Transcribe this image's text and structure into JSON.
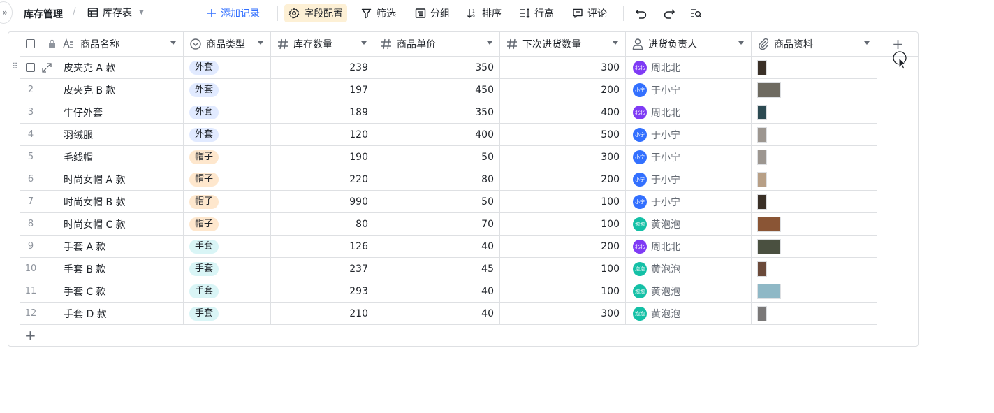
{
  "toolbar": {
    "expand_label": "»",
    "base_name": "库存管理",
    "separator": "/",
    "view_name": "库存表",
    "add_record": "添加记录",
    "field_config": "字段配置",
    "filter": "筛选",
    "group": "分组",
    "sort": "排序",
    "row_height": "行高",
    "comment": "评论"
  },
  "columns": [
    {
      "label": "商品名称",
      "icon": "text-field-icon"
    },
    {
      "label": "商品类型",
      "icon": "single-select-icon"
    },
    {
      "label": "库存数量",
      "icon": "number-field-icon"
    },
    {
      "label": "商品单价",
      "icon": "number-field-icon"
    },
    {
      "label": "下次进货数量",
      "icon": "number-field-icon"
    },
    {
      "label": "进货负责人",
      "icon": "person-field-icon"
    },
    {
      "label": "商品资料",
      "icon": "attachment-icon"
    }
  ],
  "tag_colors": {
    "外套": "#e1eaff",
    "帽子": "#fee7cd",
    "手套": "#d9f5f6"
  },
  "people": {
    "周北北": {
      "initials": "北北",
      "color": "#7f3bf5"
    },
    "于小宁": {
      "initials": "小宁",
      "color": "#3370ff"
    },
    "黄泡泡": {
      "initials": "泡泡",
      "color": "#14c0a6"
    }
  },
  "rows": [
    {
      "num": "",
      "name": "皮夹克 A 款",
      "type": "外套",
      "stock": "239",
      "price": "350",
      "next": "300",
      "owner": "周北北",
      "thumb": "portrait-dark"
    },
    {
      "num": "2",
      "name": "皮夹克 B 款",
      "type": "外套",
      "stock": "197",
      "price": "450",
      "next": "200",
      "owner": "于小宁",
      "thumb": "landscape-gray"
    },
    {
      "num": "3",
      "name": "牛仔外套",
      "type": "外套",
      "stock": "189",
      "price": "350",
      "next": "400",
      "owner": "周北北",
      "thumb": "portrait-teal"
    },
    {
      "num": "4",
      "name": "羽绒服",
      "type": "外套",
      "stock": "120",
      "price": "400",
      "next": "500",
      "owner": "于小宁",
      "thumb": "portrait-light"
    },
    {
      "num": "5",
      "name": "毛线帽",
      "type": "帽子",
      "stock": "190",
      "price": "50",
      "next": "300",
      "owner": "于小宁",
      "thumb": "portrait-light"
    },
    {
      "num": "6",
      "name": "时尚女帽 A 款",
      "type": "帽子",
      "stock": "220",
      "price": "80",
      "next": "200",
      "owner": "于小宁",
      "thumb": "portrait-beige"
    },
    {
      "num": "7",
      "name": "时尚女帽 B 款",
      "type": "帽子",
      "stock": "990",
      "price": "50",
      "next": "100",
      "owner": "于小宁",
      "thumb": "portrait-dark"
    },
    {
      "num": "8",
      "name": "时尚女帽 C 款",
      "type": "帽子",
      "stock": "80",
      "price": "70",
      "next": "100",
      "owner": "黄泡泡",
      "thumb": "landscape-brown"
    },
    {
      "num": "9",
      "name": "手套 A 款",
      "type": "手套",
      "stock": "126",
      "price": "40",
      "next": "200",
      "owner": "周北北",
      "thumb": "landscape-dark"
    },
    {
      "num": "10",
      "name": "手套 B 款",
      "type": "手套",
      "stock": "237",
      "price": "45",
      "next": "100",
      "owner": "黄泡泡",
      "thumb": "portrait-brown"
    },
    {
      "num": "11",
      "name": "手套 C 款",
      "type": "手套",
      "stock": "293",
      "price": "40",
      "next": "100",
      "owner": "黄泡泡",
      "thumb": "landscape-sky"
    },
    {
      "num": "12",
      "name": "手套 D 款",
      "type": "手套",
      "stock": "210",
      "price": "40",
      "next": "300",
      "owner": "黄泡泡",
      "thumb": "portrait-gray"
    }
  ],
  "thumb_colors": {
    "portrait-dark": "#3a3027",
    "landscape-gray": "#6e6a60",
    "portrait-teal": "#2c4a52",
    "portrait-light": "#9c9690",
    "portrait-beige": "#b79f86",
    "landscape-brown": "#8a5535",
    "landscape-dark": "#4a5040",
    "portrait-brown": "#6b4a3a",
    "landscape-sky": "#8fb8c6",
    "portrait-gray": "#7a7878"
  },
  "add_column_label": "+",
  "add_row_label": "+"
}
